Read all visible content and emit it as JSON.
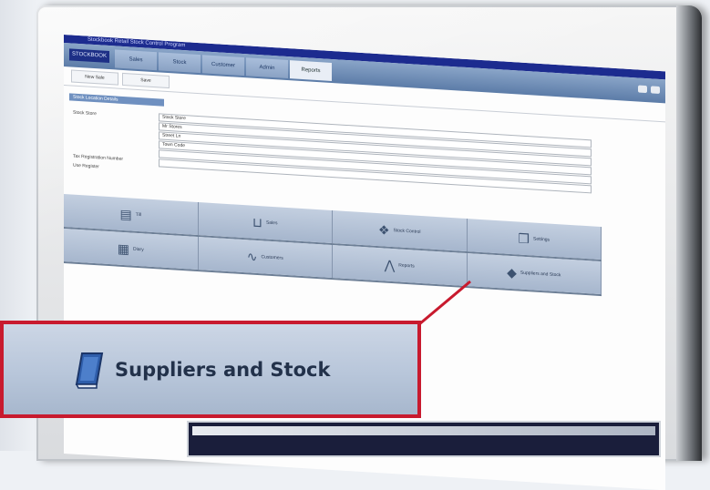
{
  "window": {
    "title": "Stockbook Retail Stock Control Program"
  },
  "navbar": {
    "brand": "STOCKBOOK",
    "tabs": [
      "Sales",
      "Stock",
      "Customer",
      "Admin",
      "Reports"
    ],
    "active_tab_index": 4
  },
  "toolbar": {
    "buttons": [
      "New Sale",
      "Save"
    ]
  },
  "section": {
    "tab_label": "Stock Location Details"
  },
  "form": {
    "store_label": "Stock Store",
    "fields": [
      "Stock Store",
      "Mr Stores",
      "Street Ln",
      "Town Code",
      ""
    ],
    "tax_label": "Tax Registration Number",
    "tax_value": "",
    "checkbox_label": "Use Register"
  },
  "tiles": [
    [
      {
        "icon": "till-icon",
        "label": "Till"
      },
      {
        "icon": "basket-icon",
        "label": "Sales"
      },
      {
        "icon": "stock-icon",
        "label": "Stock Control"
      },
      {
        "icon": "settings-icon",
        "label": "Settings"
      }
    ],
    [
      {
        "icon": "calendar-icon",
        "label": "Diary"
      },
      {
        "icon": "handshake-icon",
        "label": "Customers"
      },
      {
        "icon": "chart-icon",
        "label": "Reports"
      },
      {
        "icon": "book-icon",
        "label": "Suppliers and Stock"
      }
    ]
  ],
  "callout": {
    "label": "Suppliers and Stock",
    "icon": "book-icon",
    "border_color": "#c81a2e"
  },
  "colors": {
    "navbar": "#5c7ca8",
    "titlebar": "#1c2b8f",
    "tile": "#a6b6cd"
  }
}
